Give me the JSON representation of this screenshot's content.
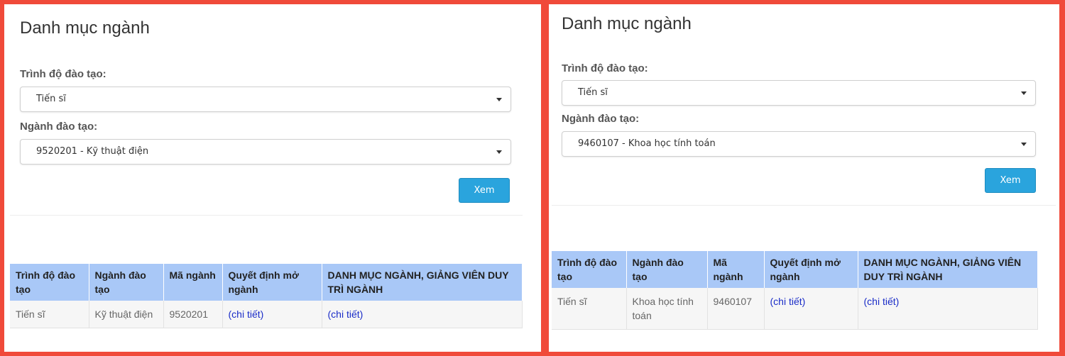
{
  "panels": [
    {
      "title": "Danh mục ngành",
      "level_label": "Trình độ đào tạo:",
      "level_value": "Tiến sĩ",
      "major_label": "Ngành đào tạo:",
      "major_value": "9520201 - Kỹ thuật điện",
      "view_button": "Xem",
      "table": {
        "headers": [
          "Trình độ đào tạo",
          "Ngành đào tạo",
          "Mã ngành",
          "Quyết định mở ngành",
          "DANH MỤC NGÀNH, GIẢNG VIÊN DUY TRÌ NGÀNH"
        ],
        "row": [
          "Tiến sĩ",
          "Kỹ thuật điện",
          "9520201",
          "(chi tiết)",
          "(chi tiết)"
        ]
      }
    },
    {
      "title": "Danh mục ngành",
      "level_label": "Trình độ đào tạo:",
      "level_value": "Tiến sĩ",
      "major_label": "Ngành đào tạo:",
      "major_value": "9460107 - Khoa học tính toán",
      "view_button": "Xem",
      "table": {
        "headers": [
          "Trình độ đào tạo",
          "Ngành đào tạo",
          "Mã ngành",
          "Quyết định mở ngành",
          "DANH MỤC NGÀNH, GIẢNG VIÊN DUY TRÌ NGÀNH"
        ],
        "row": [
          "Tiến sĩ",
          "Khoa học tính toán",
          "9460107",
          "(chi tiết)",
          "(chi tiết)"
        ]
      }
    }
  ],
  "colors": {
    "frame": "#f04a3a",
    "button": "#2aa4dd",
    "table_header": "#a9c8f7",
    "link": "#1a2cc8"
  }
}
